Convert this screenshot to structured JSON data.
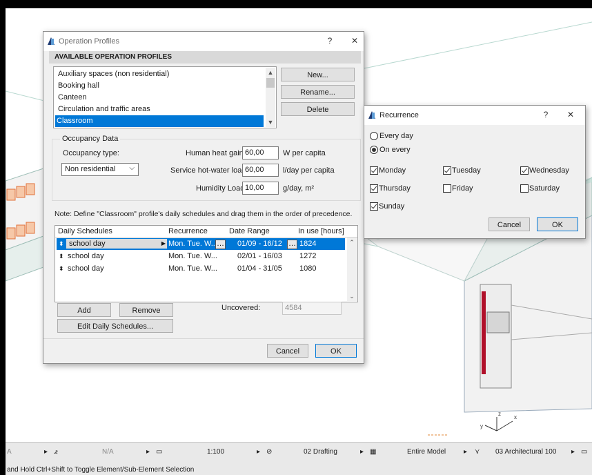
{
  "operation_profiles": {
    "title": "Operation Profiles",
    "help": "?",
    "close": "✕",
    "available_header": "AVAILABLE OPERATION PROFILES",
    "profiles": [
      "Auxiliary spaces (non residential)",
      "Booking hall",
      "Canteen",
      "Circulation and traffic areas",
      "Classroom"
    ],
    "selected_profile": "Classroom",
    "new_button": "New...",
    "rename_button": "Rename...",
    "delete_button": "Delete",
    "occupancy": {
      "group_title": "Occupancy Data",
      "type_label": "Occupancy type:",
      "type_value": "Non residential",
      "heat_gain_label": "Human heat gain:",
      "heat_gain_value": "60,00",
      "heat_gain_unit": "W per capita",
      "hot_water_label": "Service hot-water load:",
      "hot_water_value": "60,00",
      "hot_water_unit": "l/day per capita",
      "humidity_label": "Humidity Load:",
      "humidity_value": "10,00",
      "humidity_unit": "g/day, m²"
    },
    "note": "Note: Define \"Classroom\" profile's daily schedules and drag them in the order of precedence.",
    "schedule_headers": [
      "Daily Schedules",
      "Recurrence",
      "Date Range",
      "In use [hours]"
    ],
    "schedules": [
      {
        "name": "school day",
        "recurrence": "Mon. Tue. W...",
        "range": "01/09 - 16/12",
        "hours": "1824"
      },
      {
        "name": "school day",
        "recurrence": "Mon. Tue. W...",
        "range": "02/01 - 16/03",
        "hours": "1272"
      },
      {
        "name": "school day",
        "recurrence": "Mon. Tue. W...",
        "range": "01/04 - 31/05",
        "hours": "1080"
      }
    ],
    "add_button": "Add",
    "remove_button": "Remove",
    "uncovered_label": "Uncovered:",
    "uncovered_value": "4584",
    "edit_button": "Edit Daily Schedules...",
    "cancel_button": "Cancel",
    "ok_button": "OK"
  },
  "recurrence": {
    "title": "Recurrence",
    "help": "?",
    "close": "✕",
    "every_day": "Every day",
    "on_every": "On every",
    "mode": "on_every",
    "days": [
      {
        "label": "Monday",
        "checked": true
      },
      {
        "label": "Tuesday",
        "checked": true
      },
      {
        "label": "Wednesday",
        "checked": true
      },
      {
        "label": "Thursday",
        "checked": true
      },
      {
        "label": "Friday",
        "checked": false
      },
      {
        "label": "Saturday",
        "checked": false
      },
      {
        "label": "Sunday",
        "checked": true
      }
    ],
    "cancel_button": "Cancel",
    "ok_button": "OK"
  },
  "statusbar": {
    "na_left": "A",
    "na_mid": "N/A",
    "scale": "1:100",
    "drafting": "02 Drafting",
    "model": "Entire Model",
    "architectural": "03 Architectural 100",
    "hint": "and Hold Ctrl+Shift to Toggle Element/Sub-Element Selection"
  },
  "colors": {
    "accent": "#0078d7",
    "frame": "#000000",
    "dialog_bg": "#f0f0f0"
  }
}
